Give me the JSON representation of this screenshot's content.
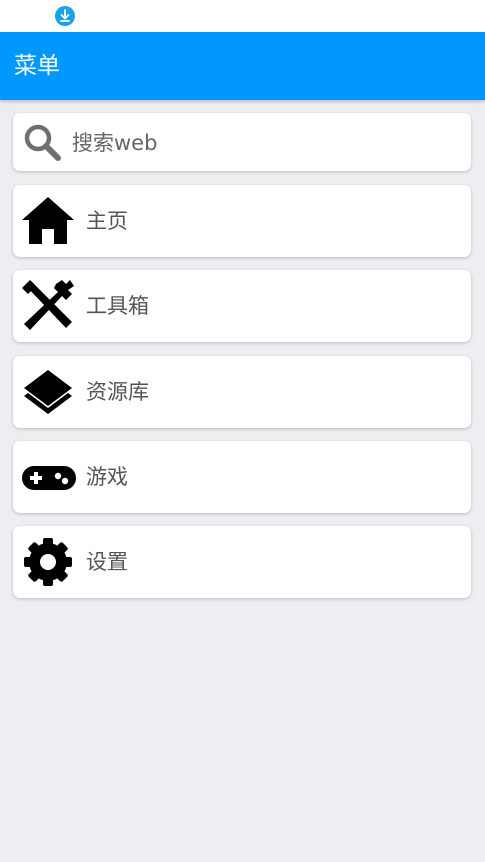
{
  "status_bar": {
    "icons": [
      "download-icon"
    ],
    "colors": {
      "download_icon": "#1aa3e8"
    }
  },
  "app_bar": {
    "title": "菜单",
    "color": "#0098ff"
  },
  "search": {
    "icon": "search-icon",
    "placeholder": "搜索web"
  },
  "menu": {
    "items": [
      {
        "icon": "home-icon",
        "label": "主页"
      },
      {
        "icon": "tools-icon",
        "label": "工具箱"
      },
      {
        "icon": "layers-icon",
        "label": "资源库"
      },
      {
        "icon": "gamepad-icon",
        "label": "游戏"
      },
      {
        "icon": "gear-icon",
        "label": "设置"
      }
    ]
  }
}
